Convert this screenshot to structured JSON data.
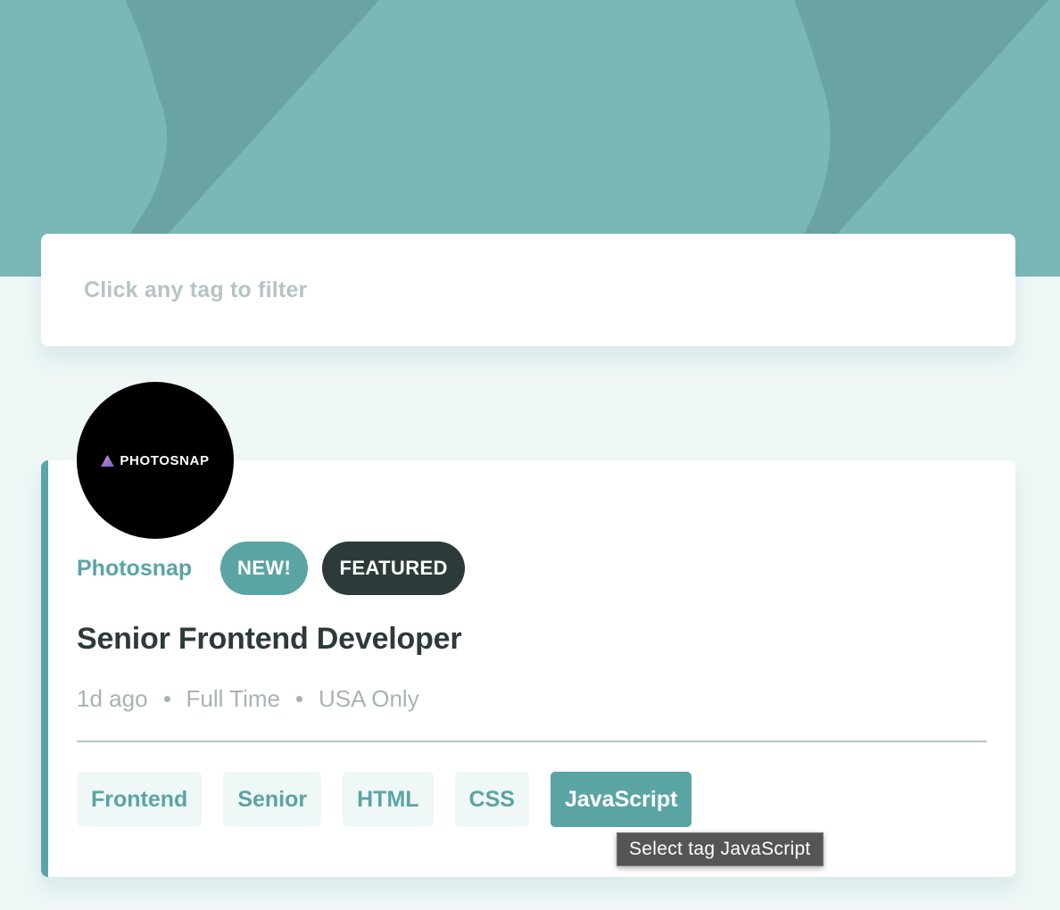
{
  "colors": {
    "banner": "#7AB8B8",
    "banner_shape": "#6AA3A3",
    "page_background": "#EFF7F7",
    "primary": "#5BA4A4",
    "dark": "#2C3A3A",
    "muted": "#A8B3B3"
  },
  "filter": {
    "placeholder": "Click any tag to filter"
  },
  "job": {
    "logo_text": "PHOTOSNAP",
    "company": "Photosnap",
    "badges": {
      "new": "NEW!",
      "featured": "FEATURED"
    },
    "title": "Senior Frontend Developer",
    "posted": "1d ago",
    "contract": "Full Time",
    "location": "USA Only",
    "tags": [
      "Frontend",
      "Senior",
      "HTML",
      "CSS",
      "JavaScript"
    ],
    "active_tag": "JavaScript"
  },
  "tooltip": {
    "text": "Select tag JavaScript"
  }
}
